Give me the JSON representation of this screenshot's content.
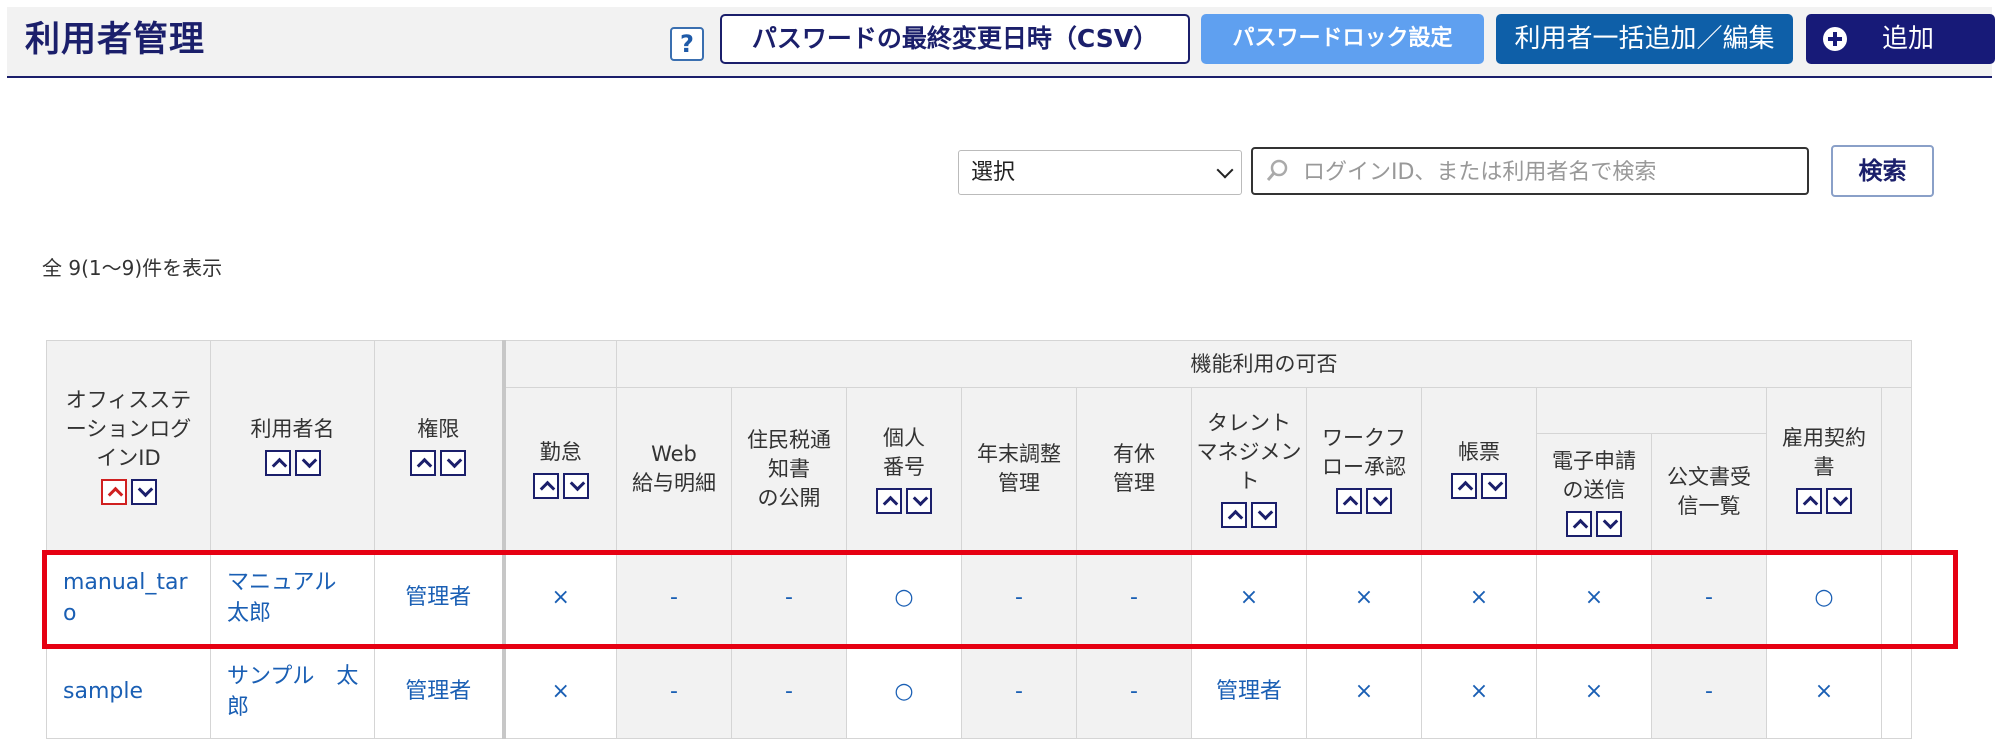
{
  "header": {
    "title": "利用者管理",
    "help_label": "?",
    "csv_button": "パスワードの最終変更日時（CSV）",
    "lock_button": "パスワードロック設定",
    "bulk_button": "利用者一括追加／編集",
    "add_button": "追加"
  },
  "search": {
    "select_value": "選択",
    "placeholder": "ログインID、または利用者名で検索",
    "button": "検索"
  },
  "count_text": "全 9(1〜9)件を表示",
  "table": {
    "group_header": "機能利用の可否",
    "columns": [
      "オフィスステーションログインID",
      "利用者名",
      "権限",
      "勤怠",
      "Web給与明細",
      "住民税通知書の公開",
      "個人番号",
      "年末調整管理",
      "有休管理",
      "タレントマネジメント",
      "ワークフロー承認",
      "帳票",
      "電子申請の送信",
      "公文書受信一覧",
      "雇用契約書"
    ],
    "col_lines": {
      "login": [
        "オフィスステ",
        "ーションログ",
        "インID"
      ],
      "web": [
        "Web",
        "給与明細"
      ],
      "jumin": [
        "住民税通",
        "知書",
        "の公開"
      ],
      "kojin": [
        "個人",
        "番号"
      ],
      "nenmatsu": [
        "年末調整",
        "管理"
      ],
      "yukyu": [
        "有休",
        "管理"
      ],
      "talent": [
        "タレント",
        "マネジメント"
      ],
      "workflow": [
        "ワークフ",
        "ロー承認"
      ],
      "denshi": [
        "電子申請",
        "の送信"
      ],
      "kobun": [
        "公文書受",
        "信一覧"
      ],
      "koyo": [
        "雇用契約",
        "書"
      ]
    },
    "rows": [
      {
        "login_id": "manual_taro",
        "login_lines": [
          "manual_tar",
          "o"
        ],
        "name_lines": [
          "マニュアル",
          "太郎"
        ],
        "role": "管理者",
        "cells": [
          "×",
          "-",
          "-",
          "○",
          "-",
          "-",
          "×",
          "×",
          "×",
          "×",
          "-",
          "○"
        ]
      },
      {
        "login_id": "sample",
        "login_lines": [
          "sample"
        ],
        "name_lines": [
          "サンプル　太",
          "郎"
        ],
        "role": "管理者",
        "cells": [
          "×",
          "-",
          "-",
          "○",
          "-",
          "-",
          "管理者",
          "×",
          "×",
          "×",
          "-",
          "×"
        ]
      }
    ]
  }
}
